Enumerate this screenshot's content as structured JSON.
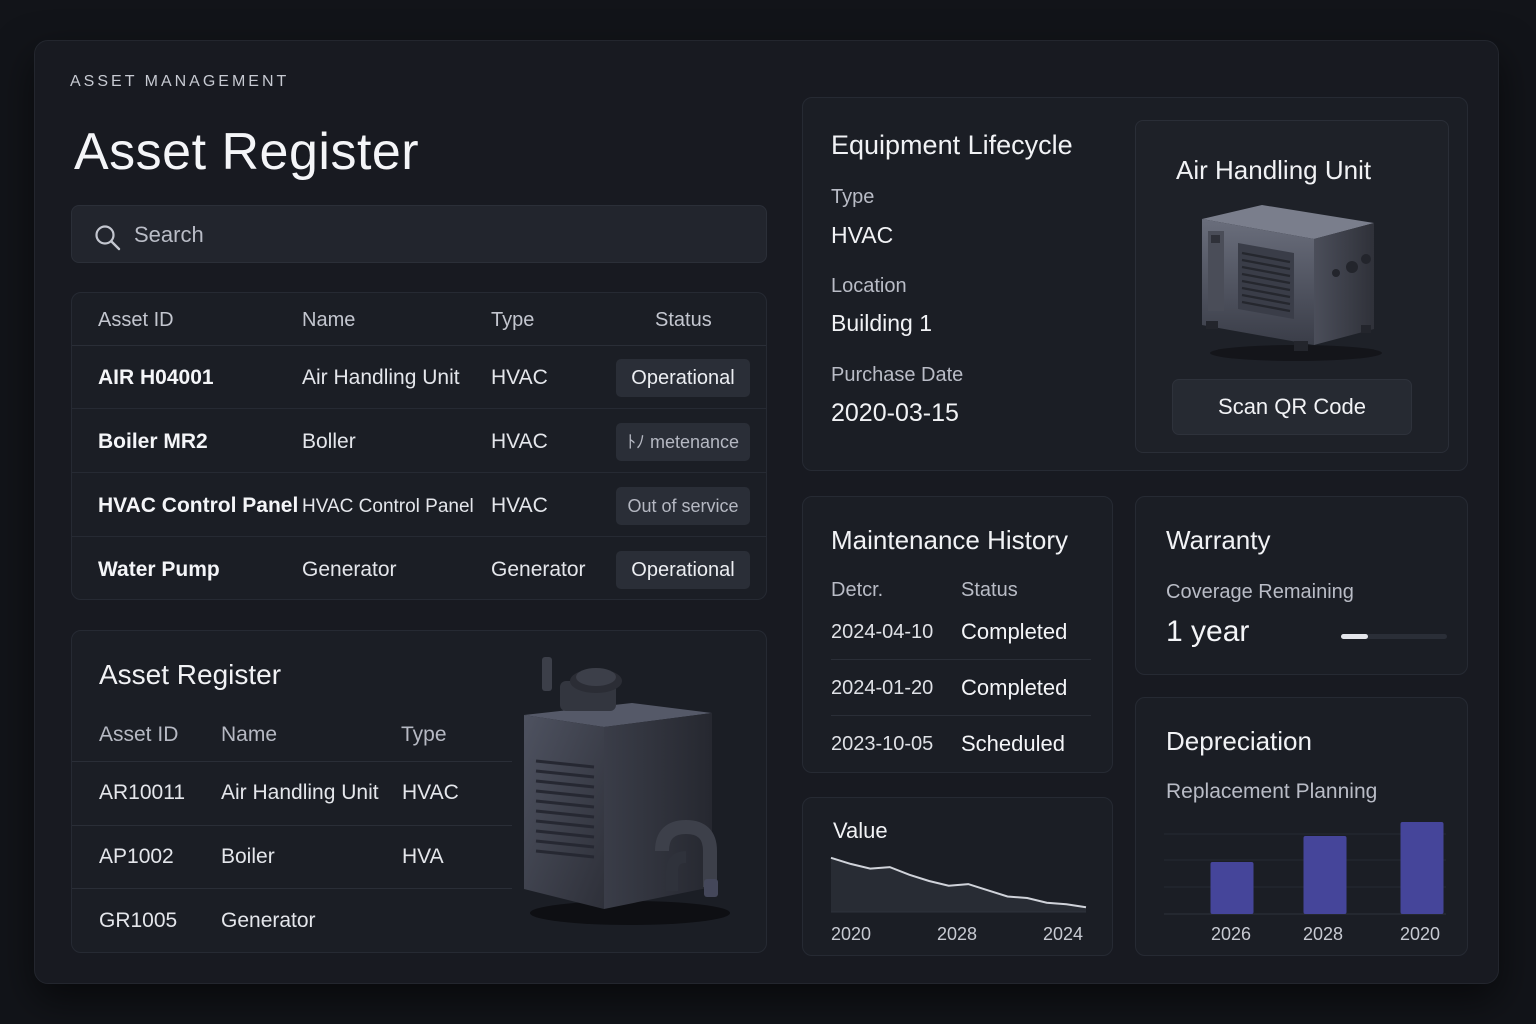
{
  "header": {
    "eyebrow": "ASSET MANAGEMENT",
    "title": "Asset Register"
  },
  "search": {
    "placeholder": "Search"
  },
  "assets_table": {
    "columns": [
      "Asset ID",
      "Name",
      "Type",
      "Status"
    ],
    "rows": [
      {
        "id": "AIR H04001",
        "name": "Air Handling Unit",
        "type": "HVAC",
        "status": "Operational"
      },
      {
        "id": "Boiler MR2",
        "name": "Boller",
        "type": "HVAC",
        "status": "ﾄﾉ metenance"
      },
      {
        "id": "HVAC Control Panel",
        "name": "HVAC Control Panel",
        "type": "HVAC",
        "status": "Out of service"
      },
      {
        "id": "Water Pump",
        "name": "Generator",
        "type": "Generator",
        "status": "Operational"
      }
    ]
  },
  "register_card": {
    "title": "Asset Register",
    "columns": [
      "Asset ID",
      "Name",
      "Type"
    ],
    "rows": [
      {
        "id": "AR10011",
        "name": "Air Handling Unit",
        "type": "HVAC"
      },
      {
        "id": "AP1002",
        "name": "Boiler",
        "type": "HVA"
      },
      {
        "id": "GR1005",
        "name": "Generator",
        "type": ""
      }
    ]
  },
  "lifecycle": {
    "title": "Equipment Lifecycle",
    "type_label": "Type",
    "type_value": "HVAC",
    "location_label": "Location",
    "location_value": "Building 1",
    "purchase_label": "Purchase Date",
    "purchase_value": "2020-03-15",
    "unit_title": "Air Handling Unit",
    "qr_button": "Scan QR Code"
  },
  "maintenance": {
    "title": "Maintenance History",
    "columns": [
      "Detcr.",
      "Status"
    ],
    "rows": [
      {
        "date": "2024-04-10",
        "status": "Completed"
      },
      {
        "date": "2024-01-20",
        "status": "Completed"
      },
      {
        "date": "2023-10-05",
        "status": "Scheduled"
      }
    ]
  },
  "warranty": {
    "title": "Warranty",
    "label": "Coverage Remaining",
    "value": "1 year",
    "progress_fraction": 0.25
  },
  "depreciation": {
    "title": "Depreciation",
    "label": "Replacement Planning"
  },
  "chart_data": [
    {
      "type": "area",
      "title": "Value",
      "x_ticks": [
        "2020",
        "2028",
        "2024"
      ],
      "values": [
        100,
        92,
        86,
        88,
        78,
        70,
        64,
        66,
        58,
        50,
        48,
        42,
        40,
        36
      ],
      "ylim": [
        30,
        110
      ],
      "line_color": "#d0d3da",
      "fill_color": "#2a2d36"
    },
    {
      "type": "bar",
      "categories": [
        "2026",
        "2028",
        "2020"
      ],
      "values": [
        52,
        78,
        92
      ],
      "ylim": [
        0,
        100
      ],
      "bar_color": "#45459a",
      "grid": true
    }
  ]
}
